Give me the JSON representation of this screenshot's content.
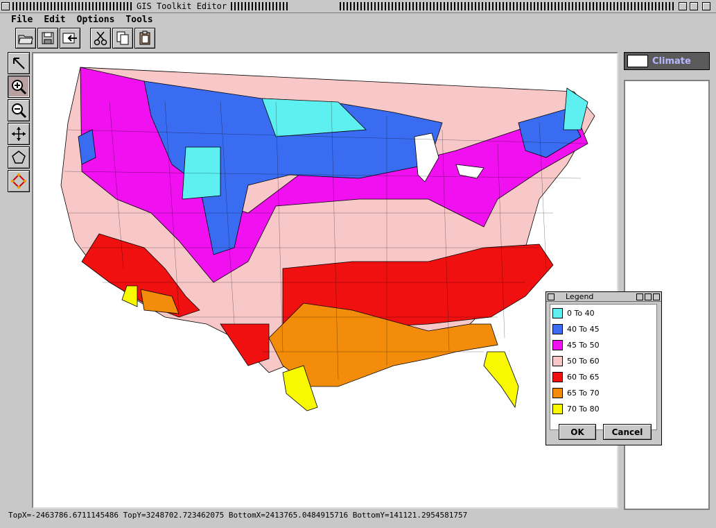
{
  "window": {
    "title": "GIS Toolkit Editor"
  },
  "menu": [
    "File",
    "Edit",
    "Options",
    "Tools"
  ],
  "toolbar": [
    "open-folder-icon",
    "save-icon",
    "import-icon",
    "cut-icon",
    "copy-icon",
    "paste-icon"
  ],
  "tools": [
    "arrow-pointer-icon",
    "zoom-in-icon",
    "zoom-out-icon",
    "pan-icon",
    "polygon-icon",
    "diamond-select-icon"
  ],
  "layers": [
    {
      "name": "Climate"
    }
  ],
  "status": "TopX=-2463786.6711145486 TopY=3248702.723462075 BottomX=2413765.0484915716 BottomY=141121.2954581757",
  "legend": {
    "title": "Legend",
    "items": [
      {
        "label": "0 To 40",
        "color": "#5ef0f0"
      },
      {
        "label": "40 To 45",
        "color": "#3a6cf2"
      },
      {
        "label": "45 To 50",
        "color": "#f010f0"
      },
      {
        "label": "50 To 60",
        "color": "#f8c8c8"
      },
      {
        "label": "60 To 65",
        "color": "#f01010"
      },
      {
        "label": "65 To 70",
        "color": "#f28c0a"
      },
      {
        "label": "70 To 80",
        "color": "#f8f800"
      }
    ],
    "ok_label": "OK",
    "cancel_label": "Cancel"
  }
}
